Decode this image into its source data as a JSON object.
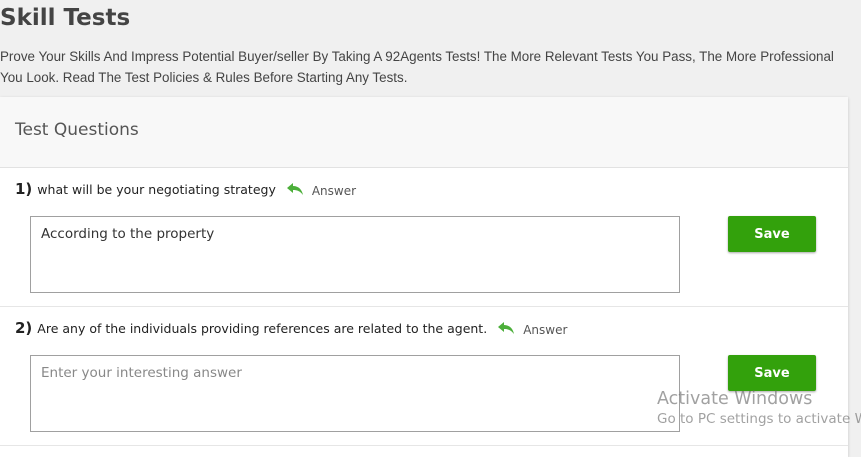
{
  "page": {
    "title": "Skill Tests",
    "intro": "Prove Your Skills And Impress Potential Buyer/seller By Taking A 92Agents Tests! The More Relevant Tests You Pass, The More Professional You Look. Read The Test Policies & Rules Before Starting Any Tests."
  },
  "card": {
    "title": "Test Questions"
  },
  "questions": [
    {
      "number": "1)",
      "text": "what will be your negotiating strategy",
      "answer_label": "Answer",
      "value": "According to the property",
      "placeholder": "Enter your interesting answer",
      "save_label": "Save"
    },
    {
      "number": "2)",
      "text": "Are any of the individuals providing references are related to the agent.",
      "answer_label": "Answer",
      "value": "",
      "placeholder": "Enter your interesting answer",
      "save_label": "Save"
    }
  ],
  "watermark": {
    "title": "Activate Windows",
    "subtitle": "Go to PC settings to activate W"
  },
  "colors": {
    "accent_green": "#33a10c",
    "reply_icon_green": "#4caf3a"
  },
  "icons": {
    "reply": "reply-arrow-icon"
  }
}
